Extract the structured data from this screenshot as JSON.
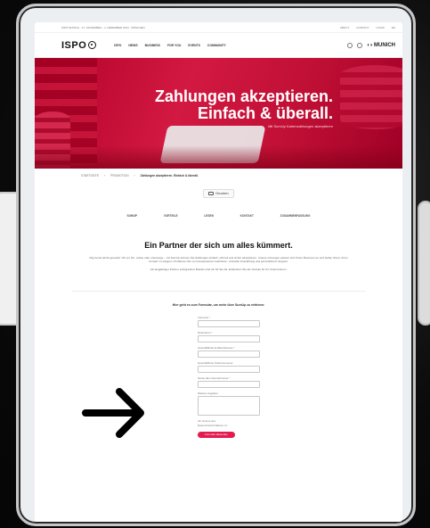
{
  "topbar": {
    "left": "ISPO MUNICH · 27. NOVEMBER – 1. DEZEMBER 2023 · MÜNCHEN",
    "links": [
      "ABOUT",
      "CONTACT",
      "LOGIN",
      "EN"
    ]
  },
  "nav": {
    "logo": "ISPO",
    "items": [
      "ISPO",
      "NEWS",
      "BUSINESS",
      "FOR YOU",
      "EVENTS",
      "COMMUNITY"
    ],
    "brand": "MUNICH"
  },
  "hero": {
    "line1": "Zahlungen akzeptieren.",
    "line2": "Einfach & überall.",
    "subtitle": "Mit SumUp Kartenzahlungen akzeptieren"
  },
  "breadcrumb": {
    "items": [
      "STARTSEITE",
      "PROMOTION",
      "Zahlungen akzeptieren. Einfach & überall."
    ]
  },
  "print": {
    "label": "Drucken"
  },
  "tabs": [
    "SUMUP",
    "VORTEILE",
    "LESEN",
    "KONTAKT",
    "ZUSAMMENFASSUNG"
  ],
  "content": {
    "headline": "Ein Partner der sich um alles kümmert.",
    "intro": "Payments leicht gemacht: Ob vor Ort, online oder unterwegs – mit SumUp können Sie Zahlungen einfach, schnell und sicher akzeptieren. Unsere Lösungen passen sich Ihrem Business an und helfen Ihnen, Ihren Umsatz zu steigern. Profitieren Sie von transparenten Gebühren, schneller Auszahlung und persönlichem Support.",
    "intro2": "Als langjähriger Partner erfolgreicher Brands sind wir für Sie da. Entdecken Sie die Vorteile für Ihr Unternehmen."
  },
  "form": {
    "title": "Hier geht es zum Formular, um mehr über SumUp zu erfahren:",
    "fields": [
      {
        "label": "Vorname *",
        "type": "input"
      },
      {
        "label": "Nachname *",
        "type": "input"
      },
      {
        "label": "Geschäftliche E-Mail-Adresse *",
        "type": "input"
      },
      {
        "label": "Geschäftliche Telefonnummer",
        "type": "input"
      },
      {
        "label": "Name des Unternehmens *",
        "type": "input"
      },
      {
        "label": "Weitere Angaben",
        "type": "textarea"
      }
    ],
    "consent": "Ich stimme den Datenschutzrichtlinien zu",
    "submit": "Formular absenden"
  },
  "overlay": {
    "arrow_icon": "arrow-right-icon"
  }
}
